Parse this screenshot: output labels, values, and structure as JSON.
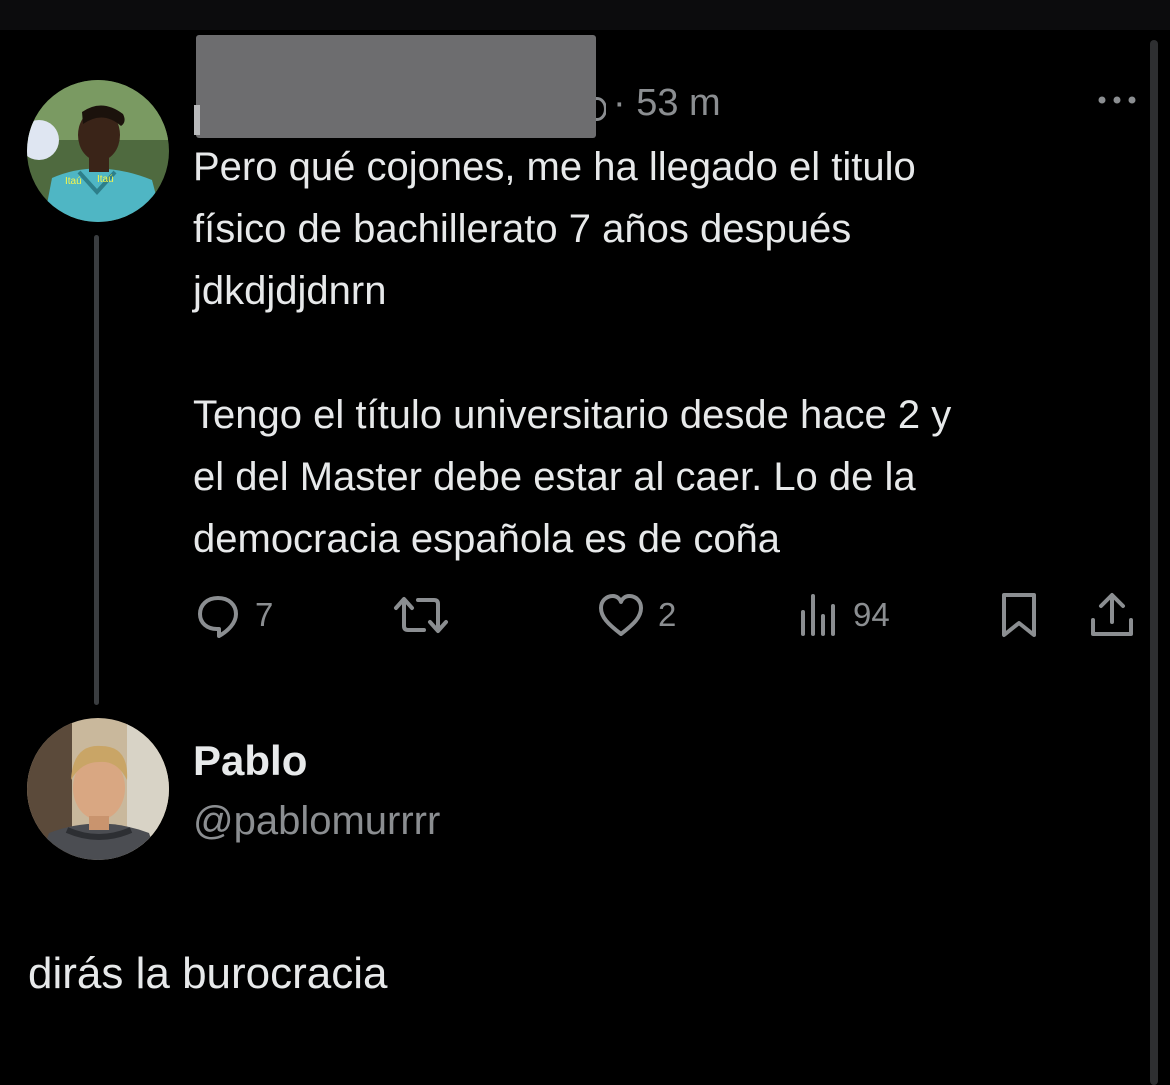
{
  "tweet": {
    "timestamp": "· 53 m",
    "text": "Pero qué cojones, me ha llegado el titulo\nfísico de bachillerato 7 años después\njdkdjdjdnrn\n\nTengo el título universitario desde hace 2 y\nel del Master debe estar al caer. Lo de la\ndemocracia española es de coña",
    "actions": {
      "reply_count": "7",
      "repost_count": "",
      "like_count": "2",
      "views_count": "94"
    },
    "avatar_icon": "avatar-photo",
    "jersey_text": "Itaú"
  },
  "reply": {
    "name": "Pablo",
    "handle": "@pablomurrrr",
    "text": "dirás la burocracia"
  },
  "colors": {
    "background": "#000000",
    "text_primary": "#e7e9ea",
    "text_secondary": "#8b8e91",
    "thread_line": "#3a3d40"
  },
  "icons": [
    "more-icon",
    "reply-icon",
    "repost-icon",
    "like-icon",
    "views-icon",
    "bookmark-icon",
    "share-icon"
  ]
}
